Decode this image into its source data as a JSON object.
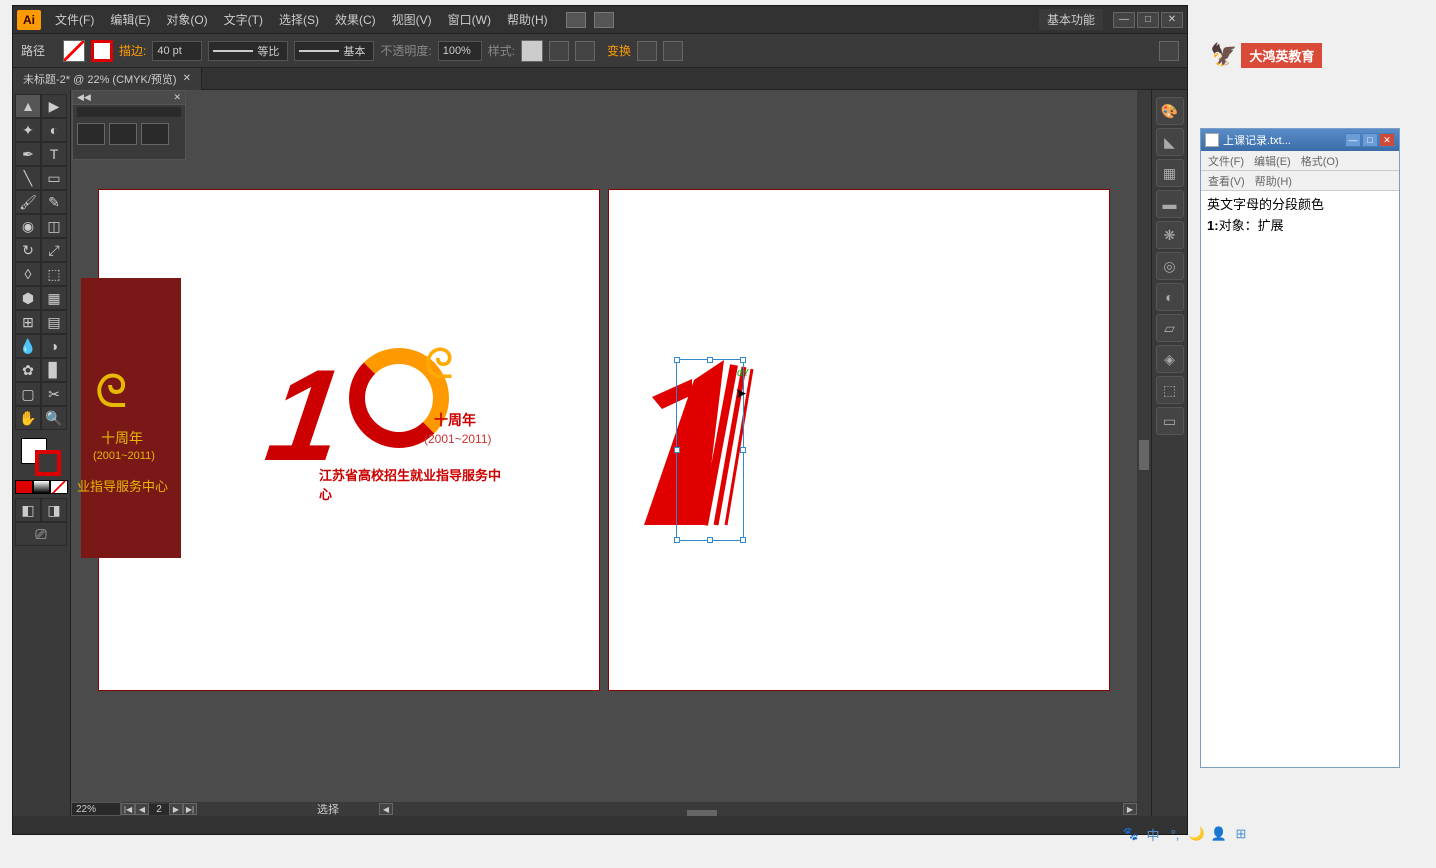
{
  "menu": {
    "file": "文件(F)",
    "edit": "编辑(E)",
    "object": "对象(O)",
    "type": "文字(T)",
    "select": "选择(S)",
    "effect": "效果(C)",
    "view": "视图(V)",
    "window": "窗口(W)",
    "help": "帮助(H)"
  },
  "workspace": "基本功能",
  "control": {
    "selection_label": "路径",
    "stroke_label": "描边:",
    "stroke_weight": "40 pt",
    "profile_label": "等比",
    "brush_label": "基本",
    "opacity_label": "不透明度:",
    "opacity_value": "100%",
    "style_label": "样式:",
    "transform_label": "变换"
  },
  "tab": {
    "title": "未标题-2* @ 22% (CMYK/预览)"
  },
  "status": {
    "zoom": "22%",
    "artboard": "2",
    "tool": "选择"
  },
  "logo": {
    "anniversary": "十周年",
    "years": "(2001~2011)",
    "org": "江苏省高校招生就业指导服务中心",
    "panel_anniversary": "十周年",
    "panel_years": "(2001~2011)",
    "panel_org": "业指导服务中心"
  },
  "smart_guide": "dY",
  "notepad": {
    "title": "上课记录.txt...",
    "menu": {
      "file": "文件(F)",
      "edit": "编辑(E)",
      "format": "格式(O)",
      "view": "查看(V)",
      "help": "帮助(H)"
    },
    "line1": "英文字母的分段颜色",
    "line2_bold": "1:",
    "line2": "对象：扩展"
  },
  "brand": "大鸿英教育",
  "ime": "中"
}
